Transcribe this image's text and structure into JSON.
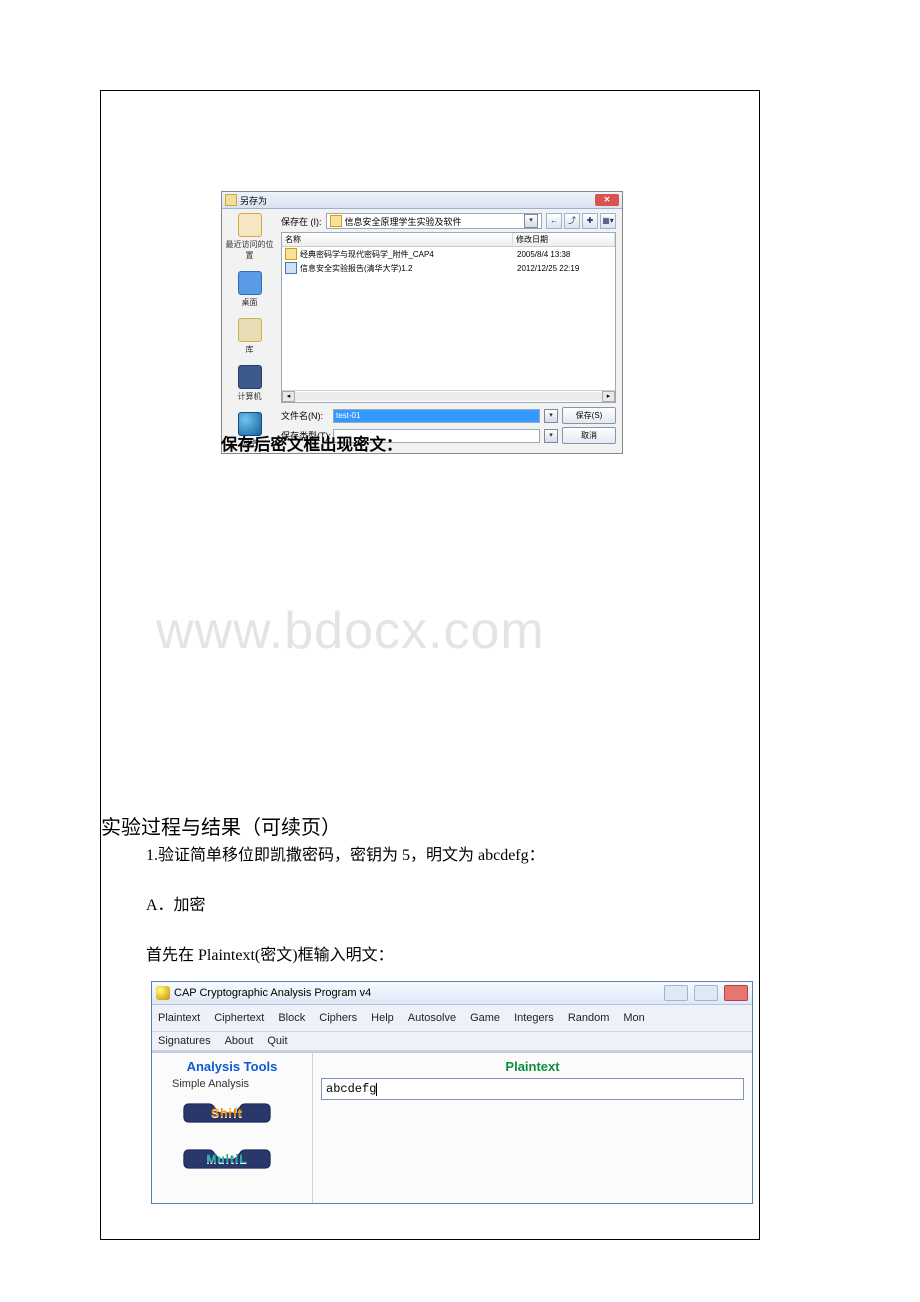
{
  "saveas": {
    "title": "另存为",
    "saveInLabel": "保存在 (I):",
    "saveInValue": "信息安全原理学生实验及软件",
    "toolbarIcons": [
      "back-icon",
      "up-icon",
      "new-folder-icon",
      "views-icon"
    ],
    "columns": {
      "name": "名称",
      "date": "修改日期"
    },
    "files": [
      {
        "icon": "folder",
        "name": "经典密码学与现代密码学_附件_CAP4",
        "date": "2005/8/4 13:38"
      },
      {
        "icon": "doc",
        "name": "信息安全实验报告(清华大学)1.2",
        "date": "2012/12/25 22:19"
      }
    ],
    "places": {
      "recent": "最近访问的位置",
      "desktop": "桌面",
      "library": "库",
      "computer": "计算机",
      "network": "网络"
    },
    "fileNameLabel": "文件名(N):",
    "fileNameValue": "test-01",
    "fileTypeLabel": "保存类型(T):",
    "fileTypeValue": "",
    "saveBtn": "保存(S)",
    "cancelBtn": "取消"
  },
  "caption1": "保存后密文框出现密文：",
  "watermark": "www.bdocx.com",
  "section": {
    "title": "实验过程与结果（可续页）",
    "line1_prefix": "1.",
    "line1_body": "验证简单移位即凯撒密码，密钥为 5，明文为 abcdefg：",
    "line2": "A．加密",
    "line3_a": "首先在 ",
    "line3_b": "Plaintext(",
    "line3_c": "密文",
    "line3_d": ")框输入明文："
  },
  "cap": {
    "title": "CAP  Cryptographic Analysis Program v4",
    "menu": [
      "Plaintext",
      "Ciphertext",
      "Block",
      "Ciphers",
      "Help",
      "Autosolve",
      "Game",
      "Integers",
      "Random",
      "Mon"
    ],
    "menu2": [
      "Signatures",
      "About",
      "Quit"
    ],
    "leftTitle": "Analysis Tools",
    "groupLabel": "Simple Analysis",
    "btnShift": "Shift",
    "btnMulti": "MultiL",
    "rightTitle": "Plaintext",
    "plainValue": "abcdefg"
  }
}
